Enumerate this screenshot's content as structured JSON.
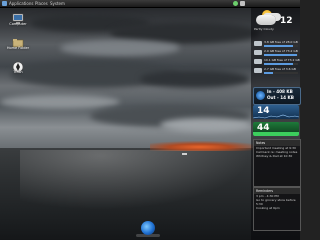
{
  "topbar": {
    "menu": [
      "Applications",
      "Places",
      "System"
    ]
  },
  "desktop_icons": [
    {
      "name": "computer-icon",
      "label": "Computer"
    },
    {
      "name": "home-folder-icon",
      "label": "Home Folder"
    },
    {
      "name": "trash-icon",
      "label": "Trash"
    }
  ],
  "weather": {
    "temperature": "12",
    "condition": "Partly Cloudy"
  },
  "drives": [
    {
      "label": "3.8 GB free of 28.0 GB",
      "used": 0.86
    },
    {
      "label": "2.0 GB free of 73.2 GB",
      "used": 0.97
    },
    {
      "label": "10.1 GB free of 73.2 GB",
      "used": 0.86
    },
    {
      "label": "2.7 GB free of 3.6 GB",
      "used": 0.25
    }
  ],
  "network": {
    "in": "In - 408 KB",
    "out": "Out - 14 KB"
  },
  "meters": [
    {
      "value": "14",
      "color": "#3f8fd9"
    },
    {
      "value": "44",
      "color": "#2ea04a"
    }
  ],
  "notes": [
    {
      "title": "Notes",
      "lines": [
        "Important meeting at 9:30",
        "",
        "Call back re: meeting notes",
        "Whitney & Dad at 10:30"
      ]
    },
    {
      "title": "Reminders",
      "lines": [
        "3 pm - 4:30 PM",
        "",
        "Go to grocery store before 5:30",
        "Cooking at 6pm"
      ]
    }
  ],
  "colors": {
    "accent": "#3f8fd9",
    "sunset": "#e8642a"
  }
}
